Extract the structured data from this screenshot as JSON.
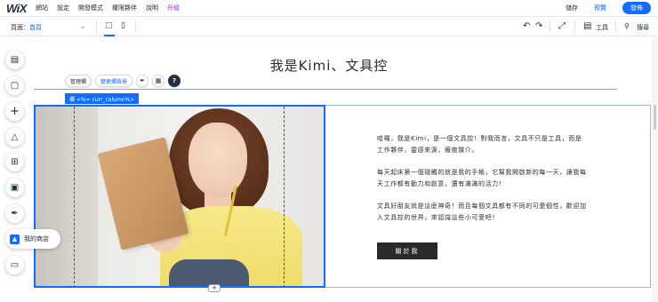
{
  "topbar": {
    "logo": "WiX",
    "menu": [
      "網站",
      "設定",
      "開發模式",
      "權限夥伴",
      "說明",
      "升級"
    ],
    "save": "儲存",
    "preview": "預覽",
    "publish": "發佈"
  },
  "toolbar": {
    "page_label": "頁面：",
    "page_name": "首頁",
    "tools_label": "工具",
    "search_label": "搜尋"
  },
  "header": {
    "site_title": "我是Kimi、文具控",
    "manage_label": "管理欄",
    "change_bg_label": "變更欄背景"
  },
  "column_tag": "欄 <%= curr_column%>",
  "about": {
    "paragraphs": [
      "哈囉，我是Kimi，是一個文具控！對我而言，文具不只是工具，而是工作夥伴，靈感來源，療癒媒介。",
      "每天起床第一個碰觸的就是我的手帳，它幫我開啟新的每一天，讓我每天工作都有動力和創意，還有滿滿的活力！",
      "文具好朋友就是這麼神奇！而且每個文具都有不同的可愛個性，歡迎加入文具控的世界，來認識這些小可愛吧！"
    ],
    "button": "關於我"
  },
  "sidebar": {
    "store_label": "我的商店",
    "icons": [
      "pages-icon",
      "background-icon",
      "add-icon",
      "design-icon",
      "apps-icon",
      "media-icon",
      "pen-icon",
      "store-icon",
      "business-icon"
    ]
  }
}
